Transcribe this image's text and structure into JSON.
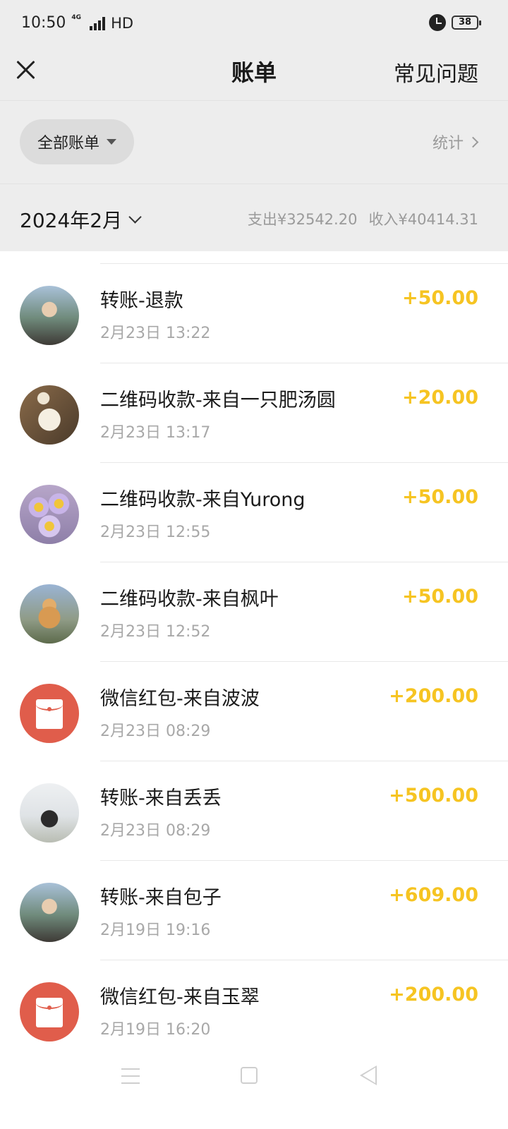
{
  "status_bar": {
    "time": "10:50",
    "network": "4G",
    "hd": "HD",
    "battery": "38"
  },
  "header": {
    "title": "账单",
    "faq": "常见问题"
  },
  "filter": {
    "label": "全部账单",
    "stats": "统计"
  },
  "month": {
    "label": "2024年2月",
    "expense": "支出¥32542.20",
    "income": "收入¥40414.31"
  },
  "transactions": [
    {
      "title": "转账-退款",
      "time": "2月23日 13:22",
      "amount": "+50.00",
      "avatar": "person-photo"
    },
    {
      "title": "二维码收款-来自一只肥汤圆",
      "time": "2月23日 13:17",
      "amount": "+20.00",
      "avatar": "bunny-photo"
    },
    {
      "title": "二维码收款-来自Yurong",
      "time": "2月23日 12:55",
      "amount": "+50.00",
      "avatar": "flowers-photo"
    },
    {
      "title": "二维码收款-来自枫叶",
      "time": "2月23日 12:52",
      "amount": "+50.00",
      "avatar": "dog-photo"
    },
    {
      "title": "微信红包-来自波波",
      "time": "2月23日 08:29",
      "amount": "+200.00",
      "avatar": "red-packet-icon"
    },
    {
      "title": "转账-来自丢丢",
      "time": "2月23日 08:29",
      "amount": "+500.00",
      "avatar": "person-arms-photo"
    },
    {
      "title": "转账-来自包子",
      "time": "2月19日 19:16",
      "amount": "+609.00",
      "avatar": "person-photo"
    },
    {
      "title": "微信红包-来自玉翠",
      "time": "2月19日 16:20",
      "amount": "+200.00",
      "avatar": "red-packet-icon"
    }
  ],
  "colors": {
    "accent_amount": "#f6c422",
    "red_packet": "#e05d4b",
    "header_bg": "#ededed"
  }
}
